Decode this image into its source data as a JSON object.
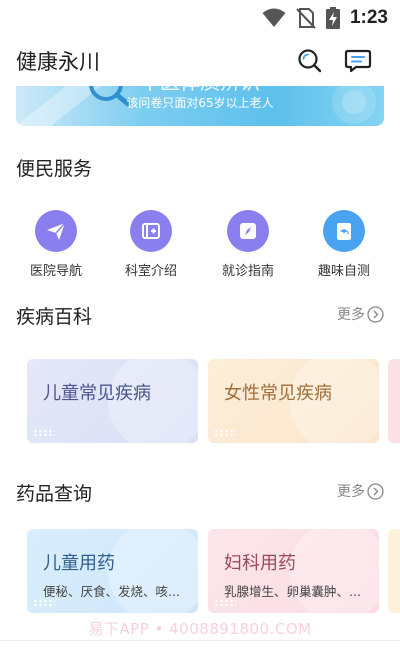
{
  "status_bar": {
    "time": "1:23"
  },
  "header": {
    "title": "健康永川",
    "search_icon": "search-icon",
    "message_icon": "message-icon"
  },
  "banner": {
    "title": "中医体质辨识",
    "subtitle": "该问卷只面对65岁以上老人"
  },
  "services": {
    "title": "便民服务",
    "items": [
      {
        "label": "医院导航",
        "icon": "paper-plane-icon",
        "color": "#8b7ff0"
      },
      {
        "label": "科室介绍",
        "icon": "department-icon",
        "color": "#8b7ff0"
      },
      {
        "label": "就诊指南",
        "icon": "compass-icon",
        "color": "#8b7ff0"
      },
      {
        "label": "趣味自测",
        "icon": "quiz-icon",
        "color": "#4aa3f0"
      }
    ]
  },
  "encyclopedia": {
    "title": "疾病百科",
    "more": "更多",
    "cards": [
      {
        "title": "儿童常见疾病"
      },
      {
        "title": "女性常见疾病"
      }
    ]
  },
  "drugs": {
    "title": "药品查询",
    "more": "更多",
    "cards": [
      {
        "title": "儿童用药",
        "subtitle": "便秘、厌食、发烧、咳..."
      },
      {
        "title": "妇科用药",
        "subtitle": "乳腺增生、卵巢囊肿、..."
      }
    ]
  },
  "watermark": "易下APP • 4008891800.COM",
  "colors": {
    "accent": "#8b7ff0",
    "banner": "#5ec0ec",
    "card_blue": "#dfe4f7",
    "card_orange": "#fdebd3",
    "card_pink": "#fbe1e6"
  }
}
